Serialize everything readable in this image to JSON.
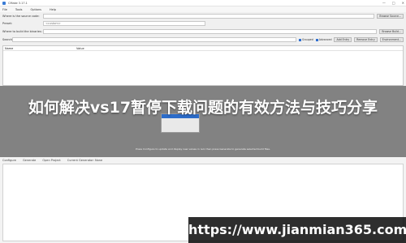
{
  "window": {
    "title": "CMake 3.17.1",
    "controls": [
      "—",
      "□",
      "✕"
    ]
  },
  "menu": [
    "File",
    "Tools",
    "Options",
    "Help"
  ],
  "source": {
    "label": "Where is the source code:",
    "value": "",
    "button": "Browse Source..."
  },
  "preset": {
    "label": "Preset:",
    "value": "<custom>"
  },
  "build": {
    "label": "Where to build the binaries:",
    "value": "",
    "button": "Browse Build..."
  },
  "search": {
    "label": "Search:",
    "value": "",
    "grouped": "Grouped",
    "advanced": "Advanced",
    "add_entry": "Add Entry",
    "remove_entry": "Remove Entry",
    "environment": "Environment..."
  },
  "table": {
    "columns": [
      "Name",
      "Value"
    ]
  },
  "status_text": "Press Configure to update and display new values in red, then press Generate to generate selected build files.",
  "lower_tabs": [
    "Configure",
    "Generate",
    "Open Project",
    "Current Generator: None"
  ],
  "banner": {
    "text": "如何解决vs17暂停下载问题的有效方法与技巧分享"
  },
  "watermark": {
    "text": "https://www.jianmian365.com"
  },
  "colors": {
    "overlay": "#787878",
    "accent": "#2c6cc9"
  }
}
